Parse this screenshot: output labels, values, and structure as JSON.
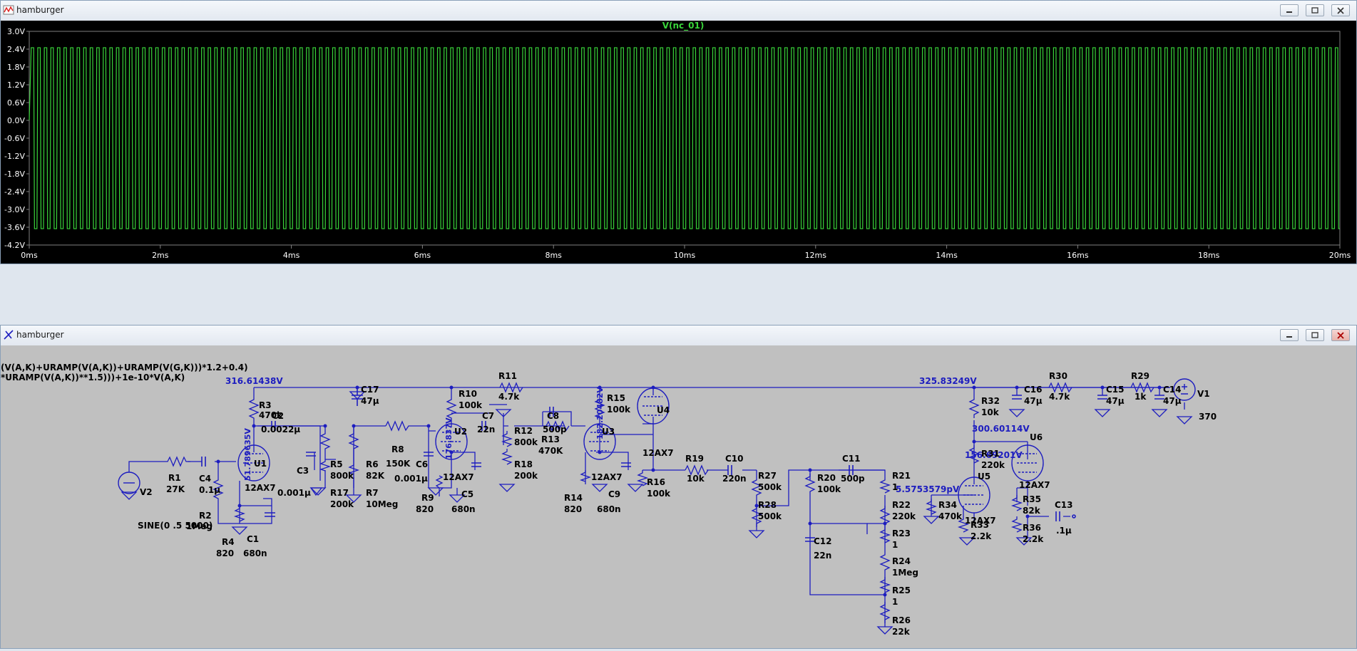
{
  "plot_window": {
    "title": "hamburger",
    "trace_label": "V(nc_01)",
    "y_ticks": [
      "3.0V",
      "2.4V",
      "1.8V",
      "1.2V",
      "0.6V",
      "0.0V",
      "-0.6V",
      "-1.2V",
      "-1.8V",
      "-2.4V",
      "-3.0V",
      "-3.6V",
      "-4.2V"
    ],
    "x_ticks": [
      "0ms",
      "2ms",
      "4ms",
      "6ms",
      "8ms",
      "10ms",
      "12ms",
      "14ms",
      "16ms",
      "18ms",
      "20ms"
    ],
    "trace_color": "#39d43a"
  },
  "chart_data": {
    "type": "line",
    "title": "V(nc_01)",
    "xlabel": "",
    "ylabel": "",
    "xlim": [
      0,
      20
    ],
    "ylim": [
      -4.2,
      3.0
    ],
    "x_unit": "ms",
    "y_unit": "V",
    "series": [
      {
        "name": "V(nc_01)",
        "waveform": "square-like",
        "frequency_hz": 5000,
        "high_v": 2.45,
        "low_v": -3.65
      }
    ]
  },
  "schematic_window": {
    "title": "hamburger",
    "directive_line1": "(V(A,K)+URAMP(V(A,K))+URAMP(V(G,K)))*1.2+0.4)",
    "directive_line2": "*URAMP(V(A,K))**1.5)))+1e-10*V(A,K)",
    "node_voltages": {
      "v1": "316.61438V",
      "v2": "51.789635V",
      "v3": "176.837V",
      "v4": "182.20482V",
      "v5": "325.83249V",
      "v6": "300.60114V",
      "v7": "156.69201V",
      "v8": "5.5753579pV"
    },
    "labels": [
      {
        "id": "R3",
        "t": "R3"
      },
      {
        "id": "R3v",
        "t": "470k"
      },
      {
        "id": "C17",
        "t": "C17"
      },
      {
        "id": "C17v",
        "t": "47µ"
      },
      {
        "id": "R10",
        "t": "R10"
      },
      {
        "id": "R10v",
        "t": "100k"
      },
      {
        "id": "R11",
        "t": "R11"
      },
      {
        "id": "R11v",
        "t": "4.7k"
      },
      {
        "id": "R15",
        "t": "R15"
      },
      {
        "id": "R15v",
        "t": "100k"
      },
      {
        "id": "U4",
        "t": "U4"
      },
      {
        "id": "U4v",
        "t": "12AX7"
      },
      {
        "id": "R32",
        "t": "R32"
      },
      {
        "id": "R32v",
        "t": "10k"
      },
      {
        "id": "C16",
        "t": "C16"
      },
      {
        "id": "C16v",
        "t": "47µ"
      },
      {
        "id": "R30",
        "t": "R30"
      },
      {
        "id": "R30v",
        "t": "4.7k"
      },
      {
        "id": "C15",
        "t": "C15"
      },
      {
        "id": "C15v",
        "t": "47µ"
      },
      {
        "id": "R29",
        "t": "R29"
      },
      {
        "id": "R29v",
        "t": "1k"
      },
      {
        "id": "C14",
        "t": "C14"
      },
      {
        "id": "C14v",
        "t": "47µ"
      },
      {
        "id": "V1",
        "t": "V1"
      },
      {
        "id": "V1v",
        "t": "370"
      },
      {
        "id": "C2",
        "t": "C2"
      },
      {
        "id": "C2v",
        "t": "0.0022µ"
      },
      {
        "id": "U1",
        "t": "U1"
      },
      {
        "id": "U1v",
        "t": "12AX7"
      },
      {
        "id": "R1",
        "t": "R1"
      },
      {
        "id": "R1v",
        "t": "27K"
      },
      {
        "id": "C4",
        "t": "C4"
      },
      {
        "id": "C4v",
        "t": "0.1µ"
      },
      {
        "id": "V2",
        "t": "V2"
      },
      {
        "id": "V2v",
        "t": "SINE(0 .5 5000)"
      },
      {
        "id": "R2",
        "t": "R2"
      },
      {
        "id": "R2v",
        "t": "1Meg"
      },
      {
        "id": "R4",
        "t": "R4"
      },
      {
        "id": "R4v",
        "t": "820"
      },
      {
        "id": "C1",
        "t": "C1"
      },
      {
        "id": "C1v",
        "t": "680n"
      },
      {
        "id": "C3",
        "t": "C3"
      },
      {
        "id": "C3v",
        "t": "0.001µ"
      },
      {
        "id": "R5",
        "t": "R5"
      },
      {
        "id": "R5v",
        "t": "800k"
      },
      {
        "id": "R17",
        "t": "R17"
      },
      {
        "id": "R17v",
        "t": "200k"
      },
      {
        "id": "R6",
        "t": "R6"
      },
      {
        "id": "R6v",
        "t": "82K"
      },
      {
        "id": "R7",
        "t": "R7"
      },
      {
        "id": "R7v",
        "t": "10Meg"
      },
      {
        "id": "R8",
        "t": "R8"
      },
      {
        "id": "R8v",
        "t": "150K"
      },
      {
        "id": "C6",
        "t": "C6"
      },
      {
        "id": "C6v",
        "t": "0.001µ"
      },
      {
        "id": "U2",
        "t": "U2"
      },
      {
        "id": "U2v",
        "t": "12AX7"
      },
      {
        "id": "R9",
        "t": "R9"
      },
      {
        "id": "R9v",
        "t": "820"
      },
      {
        "id": "C5",
        "t": "C5"
      },
      {
        "id": "C5v",
        "t": "680n"
      },
      {
        "id": "C7",
        "t": "C7"
      },
      {
        "id": "C7v",
        "t": "22n"
      },
      {
        "id": "R12",
        "t": "R12"
      },
      {
        "id": "R12v",
        "t": "800k"
      },
      {
        "id": "R18",
        "t": "R18"
      },
      {
        "id": "R18v",
        "t": "200k"
      },
      {
        "id": "C8",
        "t": "C8"
      },
      {
        "id": "C8v",
        "t": "500p"
      },
      {
        "id": "R13",
        "t": "R13"
      },
      {
        "id": "R13v",
        "t": "470K"
      },
      {
        "id": "U3",
        "t": "U3"
      },
      {
        "id": "U3v",
        "t": "12AX7"
      },
      {
        "id": "R14",
        "t": "R14"
      },
      {
        "id": "R14v",
        "t": "820"
      },
      {
        "id": "C9",
        "t": "C9"
      },
      {
        "id": "C9v",
        "t": "680n"
      },
      {
        "id": "R16",
        "t": "R16"
      },
      {
        "id": "R16v",
        "t": "100k"
      },
      {
        "id": "R19",
        "t": "R19"
      },
      {
        "id": "R19v",
        "t": "10k"
      },
      {
        "id": "C10",
        "t": "C10"
      },
      {
        "id": "C10v",
        "t": "220n"
      },
      {
        "id": "R27",
        "t": "R27"
      },
      {
        "id": "R27v",
        "t": "500k"
      },
      {
        "id": "R28",
        "t": "R28"
      },
      {
        "id": "R28v",
        "t": "500k"
      },
      {
        "id": "R20",
        "t": "R20"
      },
      {
        "id": "R20v",
        "t": "100k"
      },
      {
        "id": "C11",
        "t": "C11"
      },
      {
        "id": "C11v",
        "t": "500p"
      },
      {
        "id": "C12",
        "t": "C12"
      },
      {
        "id": "C12v",
        "t": "22n"
      },
      {
        "id": "R21",
        "t": "R21"
      },
      {
        "id": "R21v",
        "t": "1"
      },
      {
        "id": "R22",
        "t": "R22"
      },
      {
        "id": "R22v",
        "t": "220k"
      },
      {
        "id": "R23",
        "t": "R23"
      },
      {
        "id": "R23v",
        "t": "1"
      },
      {
        "id": "R24",
        "t": "R24"
      },
      {
        "id": "R24v",
        "t": "1Meg"
      },
      {
        "id": "R25",
        "t": "R25"
      },
      {
        "id": "R25v",
        "t": "1"
      },
      {
        "id": "R26",
        "t": "R26"
      },
      {
        "id": "R26v",
        "t": "22k"
      },
      {
        "id": "R31",
        "t": "R31"
      },
      {
        "id": "R31v",
        "t": "220k"
      },
      {
        "id": "U5",
        "t": "U5"
      },
      {
        "id": "U5v",
        "t": "12AX7"
      },
      {
        "id": "R34",
        "t": "R34"
      },
      {
        "id": "R34v",
        "t": "470k"
      },
      {
        "id": "R33",
        "t": "R33"
      },
      {
        "id": "R33v",
        "t": "2.2k"
      },
      {
        "id": "U6",
        "t": "U6"
      },
      {
        "id": "U6v",
        "t": "12AX7"
      },
      {
        "id": "R35",
        "t": "R35"
      },
      {
        "id": "R35v",
        "t": "82k"
      },
      {
        "id": "R36",
        "t": "R36"
      },
      {
        "id": "R36v",
        "t": "2.2k"
      },
      {
        "id": "C13",
        "t": "C13"
      },
      {
        "id": "C13v",
        "t": ".1µ"
      }
    ],
    "colors": {
      "wire": "#1d1dbf",
      "background": "#c0c0c0",
      "text": "#000000"
    }
  }
}
